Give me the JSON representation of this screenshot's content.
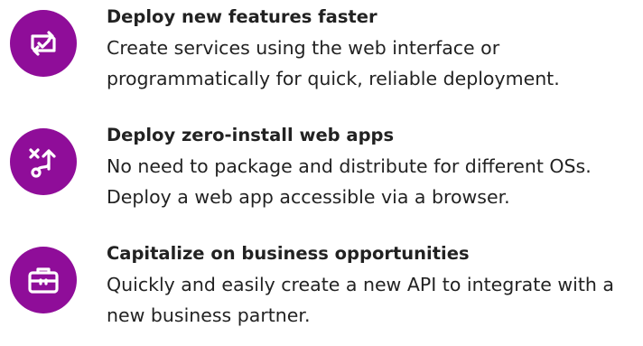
{
  "accent_color": "#8f0d99",
  "features": [
    {
      "icon": "arrows-cycle-check-icon",
      "title": "Deploy new features faster",
      "description": "Create services using the web interface or programmatically for quick, reliable deployment."
    },
    {
      "icon": "route-split-icon",
      "title": "Deploy zero-install web apps",
      "description": "No need to package and distribute for different OSs. Deploy a web app accessible via a browser."
    },
    {
      "icon": "briefcase-icon",
      "title": "Capitalize on business opportunities",
      "description": "Quickly and easily create a new API to integrate with a new business partner."
    }
  ]
}
